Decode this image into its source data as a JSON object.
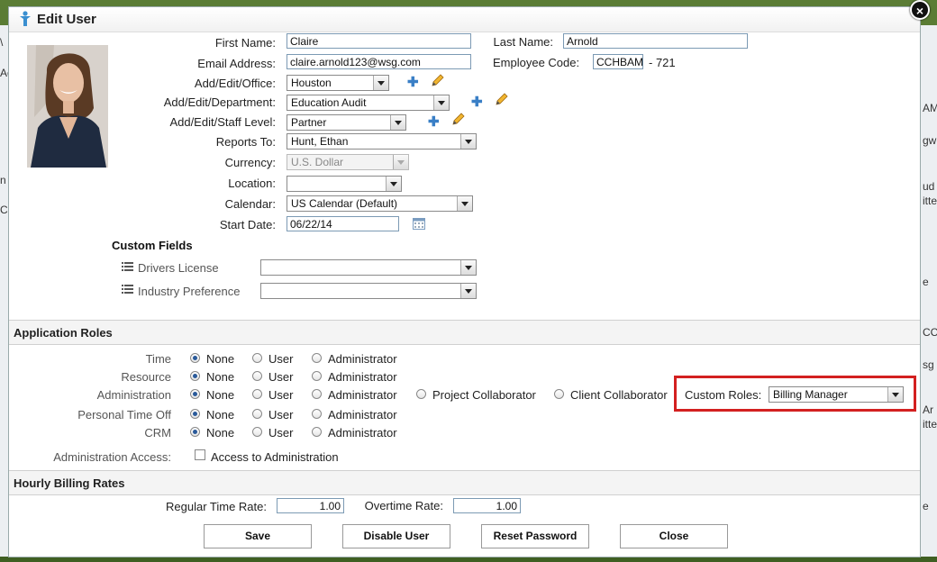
{
  "dialog": {
    "title": "Edit User",
    "close_symbol": "×"
  },
  "user": {
    "first_name_label": "First Name:",
    "first_name": "Claire",
    "last_name_label": "Last Name:",
    "last_name": "Arnold",
    "email_label": "Email Address:",
    "email": "claire.arnold123@wsg.com",
    "employee_code_label": "Employee Code:",
    "employee_code": "CCHBAM",
    "employee_code_suffix": "- 721",
    "office_label": "Add/Edit/Office:",
    "office": "Houston",
    "department_label": "Add/Edit/Department:",
    "department": "Education Audit",
    "staff_level_label": "Add/Edit/Staff Level:",
    "staff_level": "Partner",
    "reports_to_label": "Reports To:",
    "reports_to": "Hunt, Ethan",
    "currency_label": "Currency:",
    "currency": "U.S. Dollar",
    "location_label": "Location:",
    "location": "",
    "calendar_label": "Calendar:",
    "calendar": "US Calendar (Default)",
    "start_date_label": "Start Date:",
    "start_date": "06/22/14"
  },
  "custom_fields": {
    "title": "Custom Fields",
    "items": [
      {
        "label": "Drivers License",
        "value": ""
      },
      {
        "label": "Industry Preference",
        "value": ""
      }
    ]
  },
  "app_roles": {
    "title": "Application Roles",
    "option_labels": {
      "none": "None",
      "user": "User",
      "administrator": "Administrator",
      "project_collaborator": "Project Collaborator",
      "client_collaborator": "Client Collaborator"
    },
    "rows": [
      {
        "label": "Time",
        "selected": "None"
      },
      {
        "label": "Resource",
        "selected": "None"
      },
      {
        "label": "Administration",
        "selected": "None"
      },
      {
        "label": "Personal Time Off",
        "selected": "None"
      },
      {
        "label": "CRM",
        "selected": "None"
      }
    ],
    "custom_roles_label": "Custom Roles:",
    "custom_roles_value": "Billing Manager",
    "admin_access_label": "Administration Access:",
    "admin_access_checkbox_label": "Access to Administration",
    "highlight_color": "#d32020"
  },
  "billing": {
    "title": "Hourly Billing Rates",
    "regular_label": "Regular Time Rate:",
    "regular_value": "1.00",
    "overtime_label": "Overtime Rate:",
    "overtime_value": "1.00"
  },
  "buttons": {
    "save": "Save",
    "disable": "Disable User",
    "reset": "Reset Password",
    "close": "Close"
  },
  "background_fragments": {
    "left": [
      "\\",
      "Ac",
      "n",
      "C"
    ],
    "right": [
      "AM",
      "gw",
      "ud",
      "itte",
      "e",
      "CC",
      "sg",
      "Ar",
      "itte",
      "e"
    ]
  },
  "colors": {
    "accent_icon": "#3a7fc6",
    "border_frame": "#4a6b2a"
  }
}
